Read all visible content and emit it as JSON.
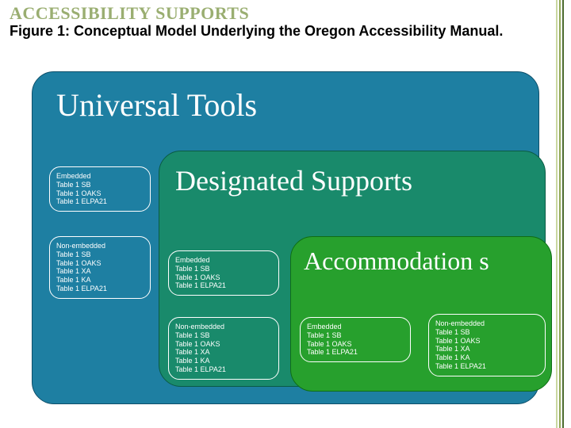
{
  "kicker": "ACCESSIBILITY SUPPORTS",
  "caption": "Figure 1: Conceptual Model Underlying the Oregon Accessibility Manual.",
  "outer": {
    "title": "Universal Tools",
    "embedded": {
      "label": "Embedded",
      "items": [
        "Table 1 SB",
        "Table 1 OAKS",
        "Table 1 ELPA21"
      ]
    },
    "nonembedded": {
      "label": "Non-embedded",
      "items": [
        "Table 1 SB",
        "Table 1 OAKS",
        "Table 1 XA",
        "Table 1 KA",
        "Table 1 ELPA21"
      ]
    }
  },
  "mid": {
    "title": "Designated Supports",
    "embedded": {
      "label": "Embedded",
      "items": [
        "Table 1 SB",
        "Table 1 OAKS",
        "Table 1 ELPA21"
      ]
    },
    "nonembedded": {
      "label": "Non-embedded",
      "items": [
        "Table 1 SB",
        "Table 1 OAKS",
        "Table 1 XA",
        "Table 1 KA",
        "Table 1 ELPA21"
      ]
    }
  },
  "inner": {
    "title": "Accommodation s",
    "embedded": {
      "label": "Embedded",
      "items": [
        "Table 1 SB",
        "Table 1 OAKS",
        "Table 1 ELPA21"
      ]
    },
    "nonembedded": {
      "label": "Non-embedded",
      "items": [
        "Table 1 SB",
        "Table 1 OAKS",
        "Table 1 XA",
        "Table 1 KA",
        "Table 1 ELPA21"
      ]
    }
  }
}
